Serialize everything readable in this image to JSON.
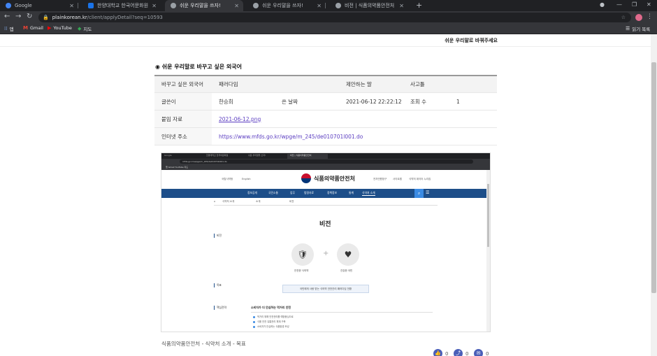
{
  "browser": {
    "tabs": [
      {
        "title": "Google",
        "active": false,
        "color": "#4285f4"
      },
      {
        "title": "한양대학교 한국어문화원",
        "active": false,
        "color": "#1a73e8"
      },
      {
        "title": "쉬운 우리말을 쓰자!",
        "active": true,
        "color": "#9aa0a6"
      },
      {
        "title": "쉬운 우리말을 쓰자!",
        "active": false,
        "color": "#9aa0a6"
      },
      {
        "title": "비전 | 식품의약품안전처",
        "active": false,
        "color": "#9aa0a6"
      }
    ],
    "new_tab": "+",
    "url_host": "plainkorean.kr",
    "url_path": "/client/applyDetail?seq=10593",
    "bookmarks": [
      {
        "label": "앱",
        "icon": "apps-icon"
      },
      {
        "label": "Gmail",
        "icon": "gmail-icon"
      },
      {
        "label": "YouTube",
        "icon": "youtube-icon"
      },
      {
        "label": "지도",
        "icon": "maps-icon"
      }
    ],
    "reading_list": "읽기 목록"
  },
  "page": {
    "top_hint": "쉬운 우리말로 바꿔주세요",
    "section_title": "쉬운 우리말로 바꾸고 싶은 외국어",
    "table": {
      "headers": [
        "바꾸고 싶은 외국어",
        "패러다임",
        "제안하는 말",
        "사고틀"
      ],
      "author_label": "글쓴이",
      "author": "한승희",
      "date_label": "쓴 날짜",
      "date": "2021-06-12 22:22:12",
      "views_label": "조회 수",
      "views": "1",
      "attachment_label": "붙임 자료",
      "attachment": "2021-06-12.png",
      "url_label": "인터넷 주소",
      "url": "https://www.mfds.go.kr/wpge/m_245/de010701l001.do"
    },
    "caption": "식품의약품안전처 - 식약처 소개 - 목표",
    "share": [
      {
        "icon": "like-icon",
        "count": "0"
      },
      {
        "icon": "share-icon",
        "count": "0"
      },
      {
        "icon": "comment-icon",
        "count": "0"
      }
    ]
  },
  "embedded": {
    "tabs": [
      "Google",
      "한양대학교 한국어문화원",
      "쉬운 우리말을 쓰자!",
      "비전 | 식품의약품안전처"
    ],
    "url": "mfds.go.kr/wpge/m_245/de010701l001.do",
    "bookmarks": "앱   Gmail   YouTube   지도",
    "util_left": [
      "국립식약청",
      "English"
    ],
    "logo": "식품의약품안전처",
    "util_right": [
      "전자민원창구",
      "사이트맵",
      "식약처 데이터 누리집"
    ],
    "nav": [
      "정보공개",
      "국민소통",
      "업무",
      "법령자료",
      "정책정보",
      "통계",
      "식약처 소개"
    ],
    "crumbs": [
      "식약처 소개",
      "소개",
      "비전"
    ],
    "page_title": "비전",
    "vision_label": "비전",
    "vision_items": [
      "안전한 식의약",
      "건강한 국민"
    ],
    "goal_label": "목표",
    "goal_text": "국민에게 사랑 받는 식의약 안전관리 패러다임 전환",
    "strategy_label": "핵심전략",
    "strategy_title": "소비자가 더 안심하는 먹거리 안전",
    "strategy_items": [
      "먹거리 위해 안전관리를 예방중심으로",
      "식품 안전 유통관리 체계 구축",
      "소비자가 안심하는 식품환경 조성"
    ]
  }
}
